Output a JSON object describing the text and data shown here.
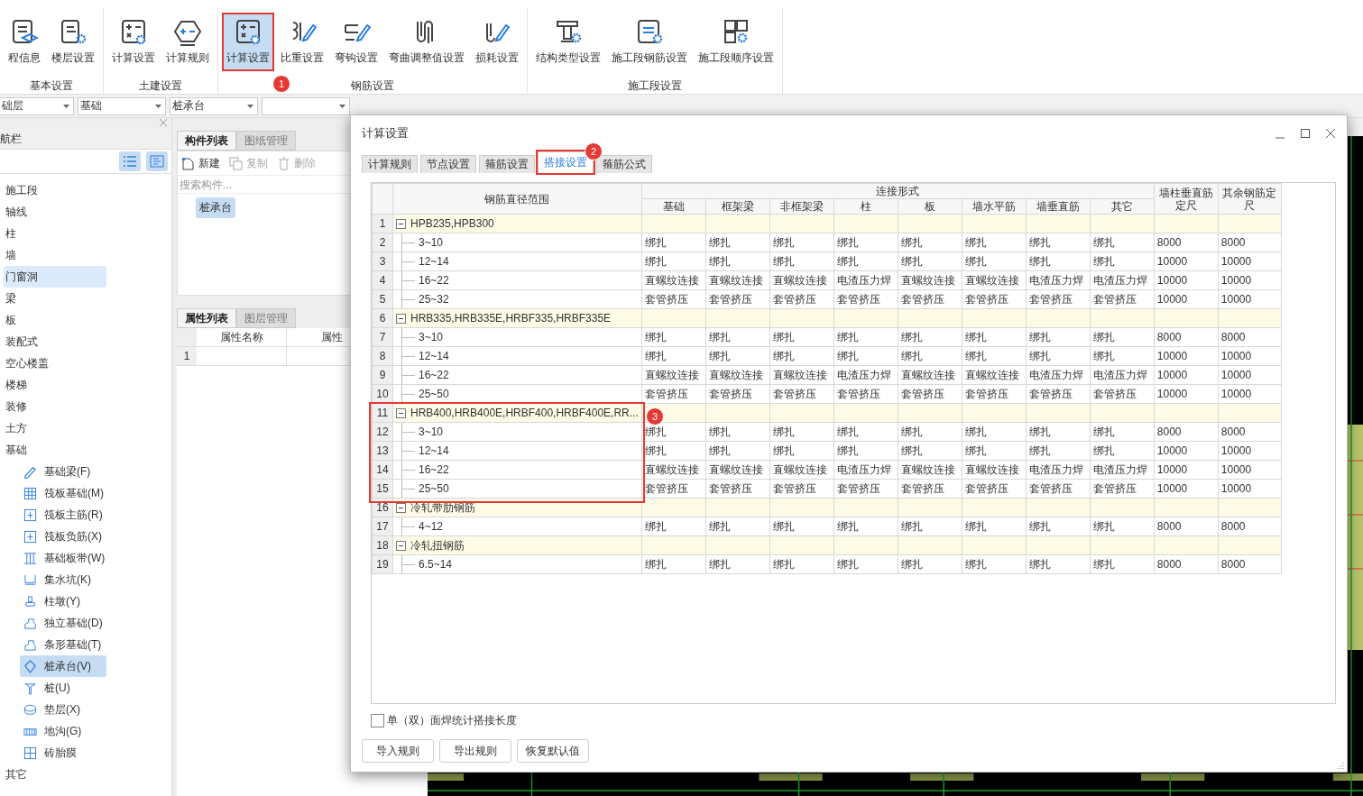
{
  "ribbon": {
    "groups": [
      {
        "label": "基本设置",
        "buttons": [
          {
            "label": "程信息",
            "selected": false
          },
          {
            "label": "楼层设置",
            "selected": false
          }
        ]
      },
      {
        "label": "土建设置",
        "buttons": [
          {
            "label": "计算设置",
            "selected": false
          },
          {
            "label": "计算规则",
            "selected": false
          }
        ]
      },
      {
        "label": "钢筋设置",
        "buttons": [
          {
            "label": "计算设置",
            "selected": true,
            "callout": "1"
          },
          {
            "label": "比重设置",
            "selected": false
          },
          {
            "label": "弯钩设置",
            "selected": false
          },
          {
            "label": "弯曲调整值设置",
            "selected": false
          },
          {
            "label": "损耗设置",
            "selected": false
          }
        ]
      },
      {
        "label": "施工段设置",
        "buttons": [
          {
            "label": "结构类型设置",
            "selected": false
          },
          {
            "label": "施工段钢筋设置",
            "selected": false
          },
          {
            "label": "施工段顺序设置",
            "selected": false
          }
        ]
      }
    ]
  },
  "selectors": [
    {
      "value": "础层"
    },
    {
      "value": "基础"
    },
    {
      "value": "桩承台"
    }
  ],
  "nav_panel": {
    "title": "航栏",
    "items": [
      {
        "label": "施工段",
        "selected": false,
        "highlighted": false
      },
      {
        "label": "轴线",
        "selected": false,
        "highlighted": false
      },
      {
        "label": "柱",
        "selected": false,
        "highlighted": false
      },
      {
        "label": "墙",
        "selected": false,
        "highlighted": false
      },
      {
        "label": "门窗洞",
        "selected": false,
        "highlighted": true
      },
      {
        "label": "梁",
        "selected": false,
        "highlighted": false
      },
      {
        "label": "板",
        "selected": false,
        "highlighted": false
      },
      {
        "label": "装配式",
        "selected": false,
        "highlighted": false
      },
      {
        "label": "空心楼盖",
        "selected": false,
        "highlighted": false
      },
      {
        "label": "楼梯",
        "selected": false,
        "highlighted": false
      },
      {
        "label": "装修",
        "selected": false,
        "highlighted": false
      },
      {
        "label": "土方",
        "selected": false,
        "highlighted": false
      },
      {
        "label": "基础",
        "selected": false,
        "highlighted": false,
        "children": [
          {
            "label": "基础梁(F)",
            "selected": false
          },
          {
            "label": "筏板基础(M)",
            "selected": false
          },
          {
            "label": "筏板主筋(R)",
            "selected": false
          },
          {
            "label": "筏板负筋(X)",
            "selected": false
          },
          {
            "label": "基础板带(W)",
            "selected": false
          },
          {
            "label": "集水坑(K)",
            "selected": false
          },
          {
            "label": "柱墩(Y)",
            "selected": false
          },
          {
            "label": "独立基础(D)",
            "selected": false
          },
          {
            "label": "条形基础(T)",
            "selected": false
          },
          {
            "label": "桩承台(V)",
            "selected": true
          },
          {
            "label": "桩(U)",
            "selected": false
          },
          {
            "label": "垫层(X)",
            "selected": false
          },
          {
            "label": "地沟(G)",
            "selected": false
          },
          {
            "label": "砖胎膜",
            "selected": false
          }
        ]
      },
      {
        "label": "其它",
        "selected": false,
        "highlighted": false
      }
    ]
  },
  "component_panel": {
    "tabs": [
      {
        "label": "构件列表",
        "selected": true
      },
      {
        "label": "图纸管理",
        "selected": false
      }
    ],
    "toolbar": [
      {
        "label": "新建",
        "disabled": false
      },
      {
        "label": "复制",
        "disabled": true
      },
      {
        "label": "删除",
        "disabled": true
      }
    ],
    "search": {
      "placeholder": "搜索构件..."
    },
    "items": [
      {
        "label": "桩承台",
        "selected": true
      }
    ]
  },
  "property_panel": {
    "tabs": [
      {
        "label": "属性列表",
        "selected": true
      },
      {
        "label": "图层管理",
        "selected": false
      }
    ],
    "columns": [
      "属性名称",
      "属性"
    ],
    "rows": [
      {
        "num": "1"
      }
    ]
  },
  "dialog": {
    "title": "计算设置",
    "tabs": [
      {
        "label": "计算规则",
        "selected": false
      },
      {
        "label": "节点设置",
        "selected": false
      },
      {
        "label": "箍筋设置",
        "selected": false
      },
      {
        "label": "搭接设置",
        "selected": true,
        "callout": "2"
      },
      {
        "label": "箍筋公式",
        "selected": false
      }
    ],
    "table": {
      "columns": {
        "range": "钢筋直径范围",
        "connection": "连接形式",
        "connection_types": [
          "基础",
          "框架梁",
          "非框架梁",
          "柱",
          "板",
          "墙水平筋",
          "墙垂直筋",
          "其它"
        ],
        "column_length": "墙柱垂直筋定尺",
        "other_length": "其余钢筋定尺"
      },
      "groups": [
        {
          "num": "1",
          "label": "HPB235,HPB300",
          "expanded": true,
          "children": [
            {
              "num": "2",
              "range": "3~10",
              "cells": [
                "绑扎",
                "绑扎",
                "绑扎",
                "绑扎",
                "绑扎",
                "绑扎",
                "绑扎",
                "绑扎"
              ],
              "column_length": "8000",
              "other_length": "8000"
            },
            {
              "num": "3",
              "range": "12~14",
              "cells": [
                "绑扎",
                "绑扎",
                "绑扎",
                "绑扎",
                "绑扎",
                "绑扎",
                "绑扎",
                "绑扎"
              ],
              "column_length": "10000",
              "other_length": "10000"
            },
            {
              "num": "4",
              "range": "16~22",
              "cells": [
                "直螺纹连接",
                "直螺纹连接",
                "直螺纹连接",
                "电渣压力焊",
                "直螺纹连接",
                "直螺纹连接",
                "电渣压力焊",
                "电渣压力焊"
              ],
              "column_length": "10000",
              "other_length": "10000"
            },
            {
              "num": "5",
              "range": "25~32",
              "cells": [
                "套管挤压",
                "套管挤压",
                "套管挤压",
                "套管挤压",
                "套管挤压",
                "套管挤压",
                "套管挤压",
                "套管挤压"
              ],
              "column_length": "10000",
              "other_length": "10000"
            }
          ]
        },
        {
          "num": "6",
          "label": "HRB335,HRB335E,HRBF335,HRBF335E",
          "expanded": true,
          "children": [
            {
              "num": "7",
              "range": "3~10",
              "cells": [
                "绑扎",
                "绑扎",
                "绑扎",
                "绑扎",
                "绑扎",
                "绑扎",
                "绑扎",
                "绑扎"
              ],
              "column_length": "8000",
              "other_length": "8000"
            },
            {
              "num": "8",
              "range": "12~14",
              "cells": [
                "绑扎",
                "绑扎",
                "绑扎",
                "绑扎",
                "绑扎",
                "绑扎",
                "绑扎",
                "绑扎"
              ],
              "column_length": "10000",
              "other_length": "10000"
            },
            {
              "num": "9",
              "range": "16~22",
              "cells": [
                "直螺纹连接",
                "直螺纹连接",
                "直螺纹连接",
                "电渣压力焊",
                "直螺纹连接",
                "直螺纹连接",
                "电渣压力焊",
                "电渣压力焊"
              ],
              "column_length": "10000",
              "other_length": "10000"
            },
            {
              "num": "10",
              "range": "25~50",
              "cells": [
                "套管挤压",
                "套管挤压",
                "套管挤压",
                "套管挤压",
                "套管挤压",
                "套管挤压",
                "套管挤压",
                "套管挤压"
              ],
              "column_length": "10000",
              "other_length": "10000"
            }
          ]
        },
        {
          "num": "11",
          "label": "HRB400,HRB400E,HRBF400,HRBF400E,RR...",
          "expanded": true,
          "callout": "3",
          "children": [
            {
              "num": "12",
              "range": "3~10",
              "cells": [
                "绑扎",
                "绑扎",
                "绑扎",
                "绑扎",
                "绑扎",
                "绑扎",
                "绑扎",
                "绑扎"
              ],
              "column_length": "8000",
              "other_length": "8000"
            },
            {
              "num": "13",
              "range": "12~14",
              "cells": [
                "绑扎",
                "绑扎",
                "绑扎",
                "绑扎",
                "绑扎",
                "绑扎",
                "绑扎",
                "绑扎"
              ],
              "column_length": "10000",
              "other_length": "10000"
            },
            {
              "num": "14",
              "range": "16~22",
              "cells": [
                "直螺纹连接",
                "直螺纹连接",
                "直螺纹连接",
                "电渣压力焊",
                "直螺纹连接",
                "直螺纹连接",
                "电渣压力焊",
                "电渣压力焊"
              ],
              "column_length": "10000",
              "other_length": "10000"
            },
            {
              "num": "15",
              "range": "25~50",
              "cells": [
                "套管挤压",
                "套管挤压",
                "套管挤压",
                "套管挤压",
                "套管挤压",
                "套管挤压",
                "套管挤压",
                "套管挤压"
              ],
              "column_length": "10000",
              "other_length": "10000"
            }
          ]
        },
        {
          "num": "16",
          "label": "冷轧带肋钢筋",
          "expanded": true,
          "children": [
            {
              "num": "17",
              "range": "4~12",
              "cells": [
                "绑扎",
                "绑扎",
                "绑扎",
                "绑扎",
                "绑扎",
                "绑扎",
                "绑扎",
                "绑扎"
              ],
              "column_length": "8000",
              "other_length": "8000"
            }
          ]
        },
        {
          "num": "18",
          "label": "冷轧扭钢筋",
          "expanded": true,
          "children": [
            {
              "num": "19",
              "range": "6.5~14",
              "cells": [
                "绑扎",
                "绑扎",
                "绑扎",
                "绑扎",
                "绑扎",
                "绑扎",
                "绑扎",
                "绑扎"
              ],
              "column_length": "8000",
              "other_length": "8000"
            }
          ]
        }
      ]
    },
    "checkbox": {
      "label": "单（双）面焊统计搭接长度",
      "checked": false
    },
    "buttons": [
      "导入规则",
      "导出规则",
      "恢复默认值"
    ]
  }
}
